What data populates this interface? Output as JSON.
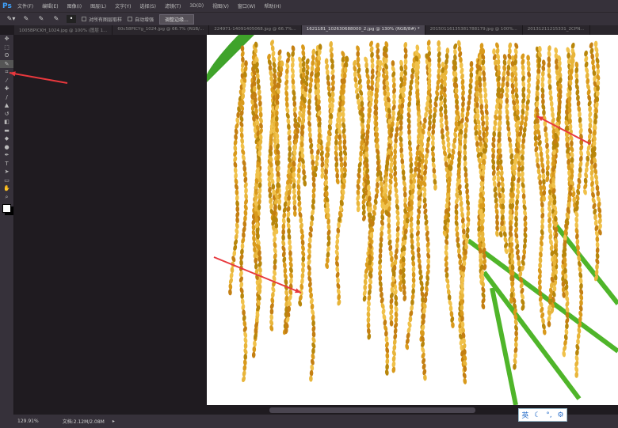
{
  "app": {
    "logo": "Ps"
  },
  "menu": [
    "文件(F)",
    "编辑(E)",
    "图像(I)",
    "图层(L)",
    "文字(Y)",
    "选择(S)",
    "滤镜(T)",
    "3D(D)",
    "视图(V)",
    "窗口(W)",
    "帮助(H)"
  ],
  "options": {
    "sample_all_layers": "对所有图层取样",
    "auto_enhance": "自动增强",
    "refine_edge": "调整边缘..."
  },
  "tabs": [
    {
      "label": "1005BPICKH_1024.jpg @ 100% (图层 1...",
      "active": false
    },
    {
      "label": "60c58PICYg_1024.jpg @ 66.7% (RGB/...",
      "active": false
    },
    {
      "label": "224971-14091405068.jpg @ 66.7%...",
      "active": false
    },
    {
      "label": "1621181_102630688000_2.jpg @ 130% (RGB/8#) *",
      "active": true
    },
    {
      "label": "20150116135381788179.jpg @ 100%...",
      "active": false
    },
    {
      "label": "20131211215331_2CPN...",
      "active": false
    }
  ],
  "tools": [
    "move-icon",
    "marquee-icon",
    "lasso-icon",
    "quick-selection-icon",
    "crop-icon",
    "eyedropper-icon",
    "healing-icon",
    "brush-icon",
    "stamp-icon",
    "history-brush-icon",
    "eraser-icon",
    "gradient-icon",
    "blur-icon",
    "dodge-icon",
    "pen-icon",
    "type-icon",
    "path-select-icon",
    "rectangle-icon",
    "hand-icon",
    "zoom-icon"
  ],
  "status": {
    "zoom": "129.91%",
    "doc": "文档:2.12M/2.08M"
  },
  "ime": {
    "lang": "英"
  },
  "colors": {
    "accent_arrow": "#e8383d",
    "ps_blue": "#3fa3ff"
  }
}
